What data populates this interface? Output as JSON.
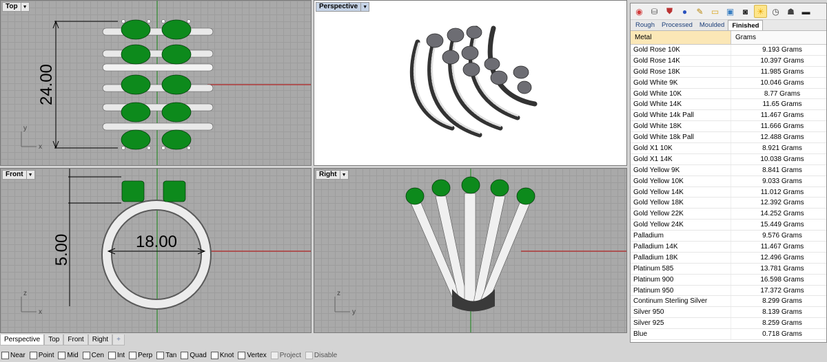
{
  "viewports": {
    "top": {
      "title": "Top",
      "dimension": "24.00",
      "axis_y": "y",
      "axis_x": "x"
    },
    "perspective": {
      "title": "Perspective"
    },
    "front": {
      "title": "Front",
      "dim_small": "5.00",
      "dim_diameter": "18.00",
      "axis_z": "z",
      "axis_x": "x"
    },
    "right": {
      "title": "Right",
      "axis_z": "z",
      "axis_y": "y"
    }
  },
  "toolbar_icons": [
    "color-wheel-icon",
    "bucket-icon",
    "shield-icon",
    "globe-icon",
    "pen-icon",
    "folder-icon",
    "picture-icon",
    "camera-icon",
    "sun-icon",
    "clock-icon",
    "lamp-icon",
    "monitor-icon"
  ],
  "tabs": [
    {
      "label": "Rough",
      "selected": false
    },
    {
      "label": "Processed",
      "selected": false
    },
    {
      "label": "Moulded",
      "selected": false
    },
    {
      "label": "Finished",
      "selected": true
    }
  ],
  "table": {
    "headers": {
      "metal": "Metal",
      "grams": "Grams"
    },
    "rows": [
      {
        "metal": "Gold Rose 10K",
        "grams": "9.193 Grams"
      },
      {
        "metal": "Gold Rose 14K",
        "grams": "10.397 Grams"
      },
      {
        "metal": "Gold Rose 18K",
        "grams": "11.985 Grams"
      },
      {
        "metal": "Gold White 9K",
        "grams": "10.046 Grams"
      },
      {
        "metal": "Gold White 10K",
        "grams": "8.77 Grams"
      },
      {
        "metal": "Gold White 14K",
        "grams": "11.65 Grams"
      },
      {
        "metal": "Gold White 14k Pall",
        "grams": "11.467 Grams"
      },
      {
        "metal": "Gold White 18K",
        "grams": "11.666 Grams"
      },
      {
        "metal": "Gold White 18k Pall",
        "grams": "12.488 Grams"
      },
      {
        "metal": "Gold X1 10K",
        "grams": "8.921 Grams"
      },
      {
        "metal": "Gold X1 14K",
        "grams": "10.038 Grams"
      },
      {
        "metal": "Gold Yellow 9K",
        "grams": "8.841 Grams"
      },
      {
        "metal": "Gold Yellow 10K",
        "grams": "9.033 Grams"
      },
      {
        "metal": "Gold Yellow 14K",
        "grams": "11.012 Grams"
      },
      {
        "metal": "Gold Yellow 18K",
        "grams": "12.392 Grams"
      },
      {
        "metal": "Gold Yellow 22K",
        "grams": "14.252 Grams"
      },
      {
        "metal": "Gold Yellow 24K",
        "grams": "15.449 Grams"
      },
      {
        "metal": "Palladium",
        "grams": "9.576 Grams"
      },
      {
        "metal": "Palladium 14K",
        "grams": "11.467 Grams"
      },
      {
        "metal": "Palladium 18K",
        "grams": "12.496 Grams"
      },
      {
        "metal": "Platinum 585",
        "grams": "13.781 Grams"
      },
      {
        "metal": "Platinum 900",
        "grams": "16.598 Grams"
      },
      {
        "metal": "Platinum 950",
        "grams": "17.372 Grams"
      },
      {
        "metal": "Continum Sterling Silver",
        "grams": "8.299 Grams"
      },
      {
        "metal": "Silver 950",
        "grams": "8.139 Grams"
      },
      {
        "metal": "Silver 925",
        "grams": "8.259 Grams"
      },
      {
        "metal": "Blue",
        "grams": "0.718 Grams"
      }
    ]
  },
  "view_tabs": [
    {
      "label": "Perspective",
      "selected": true
    },
    {
      "label": "Top",
      "selected": false
    },
    {
      "label": "Front",
      "selected": false
    },
    {
      "label": "Right",
      "selected": false
    },
    {
      "label": "+",
      "selected": false
    }
  ],
  "osnaps": [
    {
      "label": "Near",
      "enabled": true
    },
    {
      "label": "Point",
      "enabled": true
    },
    {
      "label": "Mid",
      "enabled": true
    },
    {
      "label": "Cen",
      "enabled": true
    },
    {
      "label": "Int",
      "enabled": true
    },
    {
      "label": "Perp",
      "enabled": true
    },
    {
      "label": "Tan",
      "enabled": true
    },
    {
      "label": "Quad",
      "enabled": true
    },
    {
      "label": "Knot",
      "enabled": true
    },
    {
      "label": "Vertex",
      "enabled": true
    },
    {
      "label": "Project",
      "enabled": false
    },
    {
      "label": "Disable",
      "enabled": false
    }
  ],
  "colors": {
    "emerald": "#0d8a1c",
    "metal": "#e8e8e8",
    "grid": "#a9a9a9",
    "axis_red": "#b22222",
    "axis_green": "#2e8b2e",
    "header_metal": "#fbe7b6"
  }
}
